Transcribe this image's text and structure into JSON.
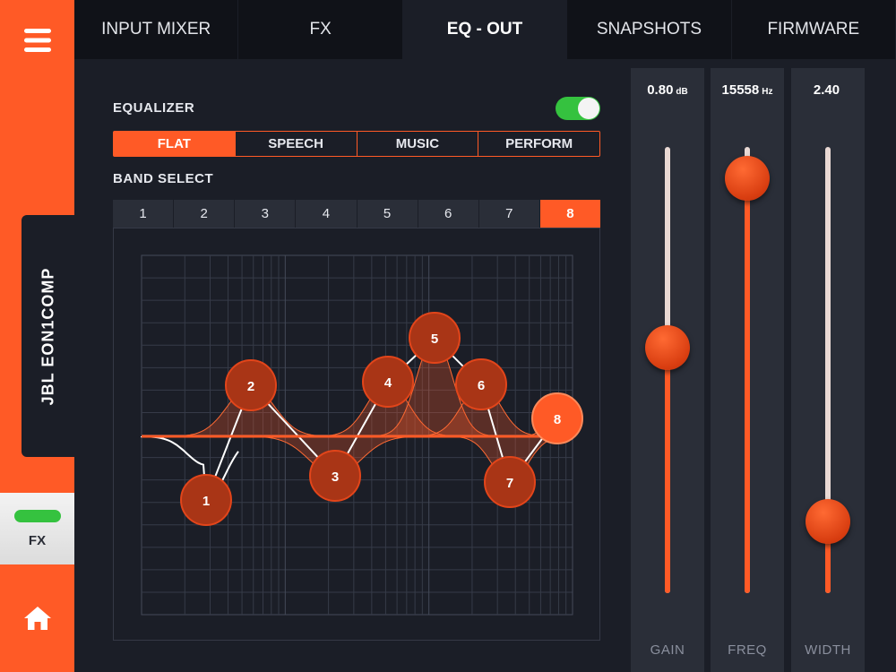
{
  "sidebar": {
    "device_name": "JBL EON1COMP",
    "fx_label": "FX"
  },
  "tabs": [
    {
      "label": "INPUT MIXER"
    },
    {
      "label": "FX"
    },
    {
      "label": "EQ - OUT",
      "active": true
    },
    {
      "label": "SNAPSHOTS"
    },
    {
      "label": "FIRMWARE"
    }
  ],
  "equalizer": {
    "title": "EQUALIZER",
    "enabled": true,
    "presets": [
      {
        "label": "FLAT",
        "active": true
      },
      {
        "label": "SPEECH"
      },
      {
        "label": "MUSIC"
      },
      {
        "label": "PERFORM"
      }
    ],
    "band_select_title": "BAND SELECT",
    "bands": [
      "1",
      "2",
      "3",
      "4",
      "5",
      "6",
      "7",
      "8"
    ],
    "selected_band": "8",
    "nodes": [
      "1",
      "2",
      "3",
      "4",
      "5",
      "6",
      "7",
      "8"
    ]
  },
  "sliders": {
    "gain": {
      "label": "GAIN",
      "value": "0.80",
      "unit": "dB",
      "level": 0.55
    },
    "freq": {
      "label": "FREQ",
      "value": "15558",
      "unit": "Hz",
      "level": 0.93
    },
    "width": {
      "label": "WIDTH",
      "value": "2.40",
      "unit": "",
      "level": 0.16
    }
  },
  "colors": {
    "accent": "#ff5a26",
    "background": "#1b1e27",
    "panel": "#2a2e38",
    "toggle_on": "#35c23f"
  }
}
